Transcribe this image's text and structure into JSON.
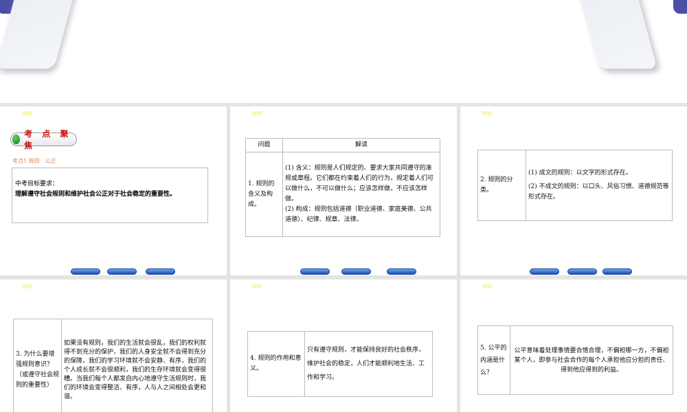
{
  "slide1": {
    "badge": "考 点 聚 焦",
    "subtitle": "考点1  规则　公正",
    "req_label": "中考目标要求：",
    "req_text": "理解遵守社会规则和维护社会公正对于社会稳定的重要性。"
  },
  "slide2": {
    "head_q": "问题",
    "head_a": "解读",
    "q": "1. 规则的含义及构成。",
    "a1": "(1) 含义：规则是人们规定的、要求大家共同遵守的准规或章程。它们都在约束着人们的行为，规定着人们可以做什么，不可以做什么；应该怎样做，不应该怎样做。",
    "a2": "(2) 构成：规则包括道德（职业道德、家庭美德、公共道德）、纪律、规章、法律。"
  },
  "slide3": {
    "q": "2. 规则的分类。",
    "a1": "(1) 成文的规则：以文字的形式存在。",
    "a2": "(2) 不成文的规则：以口头、风俗习惯、道德规范等形式存在。"
  },
  "slide4": {
    "q": "3. 为什么要增强规则意识？（或遵守社会规则的重要性）",
    "a": "如果没有规则，我们的生活就会很乱，我们的权利就得不到充分的保护，我们的人身安全就不会得到充分的保障，我们的学习环境就不会安静、有序，我们的个人成长就不会很顺利，我们的生存环境就会变得很糟。当我们每个人都发自内心地遵守生活规则时，我们的环境会变得整洁、有序，人与人之间相处会更和谐。"
  },
  "slide5": {
    "q": "4. 规则的作用和意义。",
    "a": "只有遵守规则，才能保持良好的社会秩序，维护社会的稳定，人们才能顺利地生活、工作和学习。"
  },
  "slide6": {
    "q": "5. 公平的内涵是什么？",
    "a": "公平意味着处理事情要合情合理，不偏袒哪一方，不偏袒某个人，即参与社会合作的每个人承担他应分担的责任、得到他应得到的利益。"
  }
}
